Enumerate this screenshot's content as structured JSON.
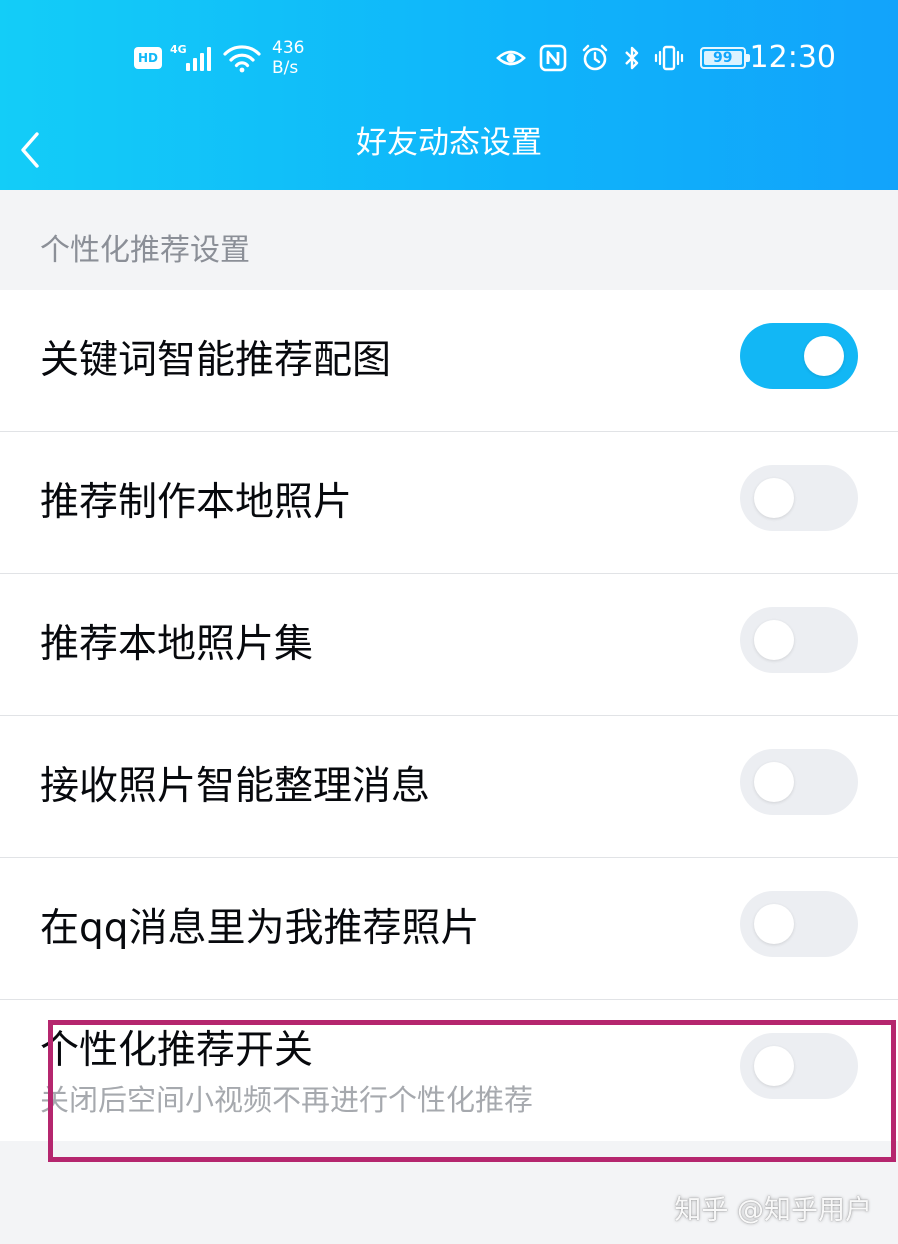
{
  "status_bar": {
    "hd_label": "HD",
    "network_type": "4G",
    "speed_value": "436",
    "speed_unit": "B/s",
    "battery_level": "99",
    "time": "12:30"
  },
  "nav": {
    "title": "好友动态设置"
  },
  "section": {
    "title": "个性化推荐设置"
  },
  "settings": [
    {
      "label": "关键词智能推荐配图",
      "on": true
    },
    {
      "label": "推荐制作本地照片",
      "on": false
    },
    {
      "label": "推荐本地照片集",
      "on": false
    },
    {
      "label": "接收照片智能整理消息",
      "on": false
    },
    {
      "label": "在qq消息里为我推荐照片",
      "on": false
    },
    {
      "label": "个性化推荐开关",
      "description": "关闭后空间小视频不再进行个性化推荐",
      "on": false
    }
  ],
  "watermark": "知乎 @知乎用户",
  "colors": {
    "header_start": "#13cdf8",
    "header_end": "#12a3fb",
    "toggle_on": "#12b7f5",
    "toggle_off": "#eceef2",
    "highlight_border": "#b5266e"
  }
}
